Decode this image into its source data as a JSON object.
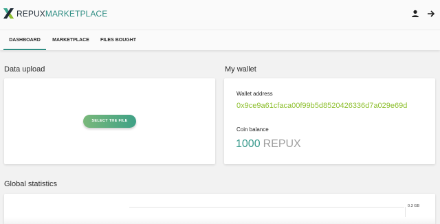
{
  "header": {
    "brand_part1": "REPUX",
    "brand_part2": "MARKETPLACE"
  },
  "icons": [
    "logo-icon",
    "user-icon",
    "logout-arrow-icon"
  ],
  "tabs": [
    {
      "label": "DASHBOARD",
      "active": true
    },
    {
      "label": "MARKETPLACE",
      "active": false
    },
    {
      "label": "FILES BOUGHT",
      "active": false
    }
  ],
  "data_upload": {
    "title": "Data upload",
    "button_label": "SELECT THE FILE"
  },
  "wallet": {
    "title": "My wallet",
    "address_label": "Wallet address",
    "address": "0x9ce9a61cfaca00f99b5d8520426336d7a029e69d",
    "balance_label": "Coin balance",
    "balance_amount": "1000",
    "balance_unit": "REPUX"
  },
  "statistics": {
    "title": "Global statistics",
    "axis_tick": "0.3 GB"
  },
  "colors": {
    "accent": "#2f8d83",
    "address": "#8dbf2d",
    "button_start": "#79b87a",
    "button_end": "#3fa186"
  }
}
